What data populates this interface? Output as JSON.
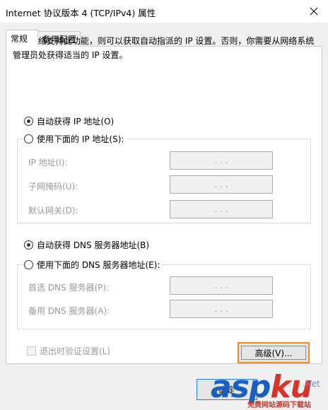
{
  "window": {
    "title": "Internet 协议版本 4 (TCP/IPv4) 属性"
  },
  "tabs": [
    {
      "label": "常规",
      "active": true
    },
    {
      "label": "备用配置",
      "active": false
    }
  ],
  "description": "如果网络支持此功能，则可以获取自动指派的 IP 设置。否则，你需要从网络系统管理员处获得适当的 IP 设置。",
  "ip_section": {
    "auto_radio": {
      "label": "自动获得 IP 地址(O)",
      "checked": true
    },
    "manual_radio": {
      "label": "使用下面的 IP 地址(S):",
      "checked": false
    },
    "fields": [
      {
        "label": "IP 地址(I):",
        "value": ".   .   ."
      },
      {
        "label": "子网掩码(U):",
        "value": ".   .   ."
      },
      {
        "label": "默认网关(D):",
        "value": ".   .   ."
      }
    ]
  },
  "dns_section": {
    "auto_radio": {
      "label": "自动获得 DNS 服务器地址(B)",
      "checked": true
    },
    "manual_radio": {
      "label": "使用下面的 DNS 服务器地址(E):",
      "checked": false
    },
    "fields": [
      {
        "label": "首选 DNS 服务器(P):",
        "value": ".   .   ."
      },
      {
        "label": "备用 DNS 服务器(A):",
        "value": ".   .   ."
      }
    ]
  },
  "validate_checkbox": {
    "label": "退出时验证设置(L)",
    "checked": false
  },
  "buttons": {
    "advanced": "高级(V)...",
    "ok": "确定"
  },
  "watermark": {
    "text_a": "asp",
    "text_b": "ku",
    "sub": "免费网站源码下载站",
    "dotcom": ".Net"
  },
  "colors": {
    "focus_orange": "#f08a24",
    "watermark_blue": "#1a5fc0",
    "watermark_red": "#d8342b"
  }
}
